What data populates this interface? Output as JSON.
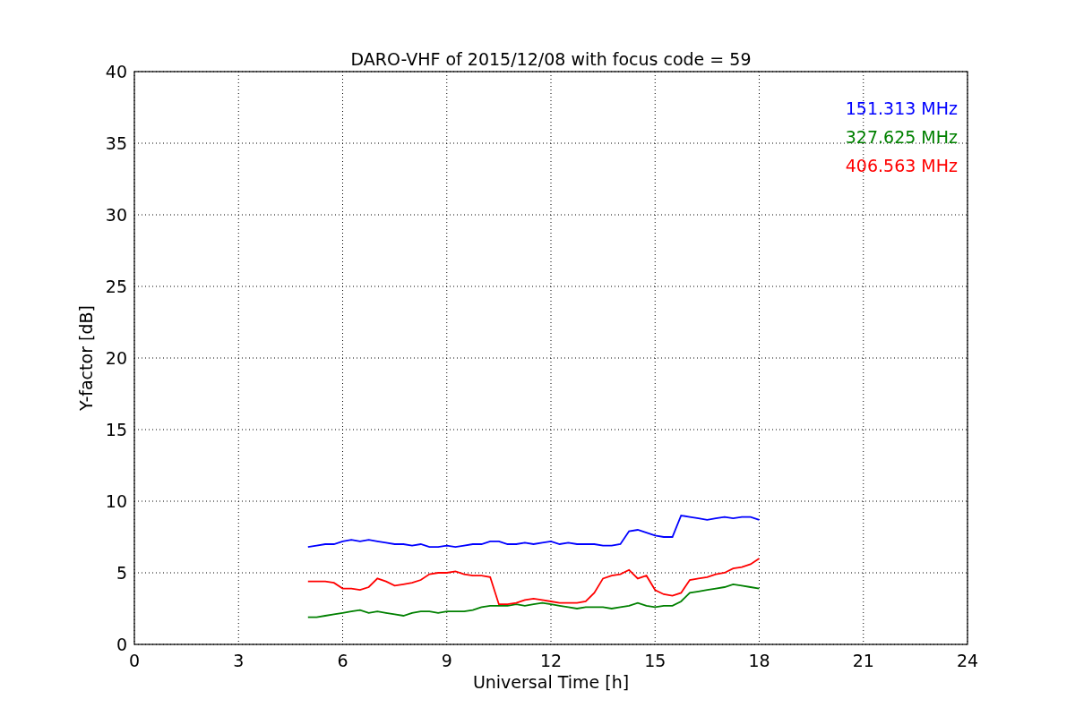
{
  "chart_data": {
    "type": "line",
    "title": "DARO-VHF of 2015/12/08 with focus code = 59",
    "xlabel": "Universal Time [h]",
    "ylabel": "Y-factor [dB]",
    "x": [
      5,
      5.25,
      5.5,
      5.75,
      6,
      6.25,
      6.5,
      6.75,
      7,
      7.25,
      7.5,
      7.75,
      8,
      8.25,
      8.5,
      8.75,
      9,
      9.25,
      9.5,
      9.75,
      10,
      10.25,
      10.5,
      10.75,
      11,
      11.25,
      11.5,
      11.75,
      12,
      12.25,
      12.5,
      12.75,
      13,
      13.25,
      13.5,
      13.75,
      14,
      14.25,
      14.5,
      14.75,
      15,
      15.25,
      15.5,
      15.75,
      16,
      16.25,
      16.5,
      16.75,
      17,
      17.25,
      17.5,
      17.75,
      18
    ],
    "series": [
      {
        "name": "151.313 MHz",
        "color": "#0000ff",
        "values": [
          6.8,
          6.9,
          7.0,
          7.0,
          7.2,
          7.3,
          7.2,
          7.3,
          7.2,
          7.1,
          7.0,
          7.0,
          6.9,
          7.0,
          6.8,
          6.8,
          6.9,
          6.8,
          6.9,
          7.0,
          7.0,
          7.2,
          7.2,
          7.0,
          7.0,
          7.1,
          7.0,
          7.1,
          7.2,
          7.0,
          7.1,
          7.0,
          7.0,
          7.0,
          6.9,
          6.9,
          7.0,
          7.9,
          8.0,
          7.8,
          7.6,
          7.5,
          7.5,
          9.0,
          8.9,
          8.8,
          8.7,
          8.8,
          8.9,
          8.8,
          8.9,
          8.9,
          8.7
        ]
      },
      {
        "name": "327.625 MHz",
        "color": "#008000",
        "values": [
          1.9,
          1.9,
          2.0,
          2.1,
          2.2,
          2.3,
          2.4,
          2.2,
          2.3,
          2.2,
          2.1,
          2.0,
          2.2,
          2.3,
          2.3,
          2.2,
          2.3,
          2.3,
          2.3,
          2.4,
          2.6,
          2.7,
          2.7,
          2.7,
          2.8,
          2.7,
          2.8,
          2.9,
          2.8,
          2.7,
          2.6,
          2.5,
          2.6,
          2.6,
          2.6,
          2.5,
          2.6,
          2.7,
          2.9,
          2.7,
          2.6,
          2.7,
          2.7,
          3.0,
          3.6,
          3.7,
          3.8,
          3.9,
          4.0,
          4.2,
          4.1,
          4.0,
          3.9
        ]
      },
      {
        "name": "406.563 MHz",
        "color": "#ff0000",
        "values": [
          4.4,
          4.4,
          4.4,
          4.3,
          3.9,
          3.9,
          3.8,
          4.0,
          4.6,
          4.4,
          4.1,
          4.2,
          4.3,
          4.5,
          4.9,
          5.0,
          5.0,
          5.1,
          4.9,
          4.8,
          4.8,
          4.7,
          2.8,
          2.8,
          2.9,
          3.1,
          3.2,
          3.1,
          3.0,
          2.9,
          2.9,
          2.9,
          3.0,
          3.6,
          4.6,
          4.8,
          4.9,
          5.2,
          4.6,
          4.8,
          3.8,
          3.5,
          3.4,
          3.6,
          4.5,
          4.6,
          4.7,
          4.9,
          5.0,
          5.3,
          5.4,
          5.6,
          6.0
        ]
      }
    ],
    "grid": true,
    "xlim": [
      0,
      24
    ],
    "ylim": [
      0,
      40
    ],
    "xticks": [
      0,
      3,
      6,
      9,
      12,
      15,
      18,
      21,
      24
    ],
    "yticks": [
      0,
      5,
      10,
      15,
      20,
      25,
      30,
      35,
      40
    ]
  }
}
